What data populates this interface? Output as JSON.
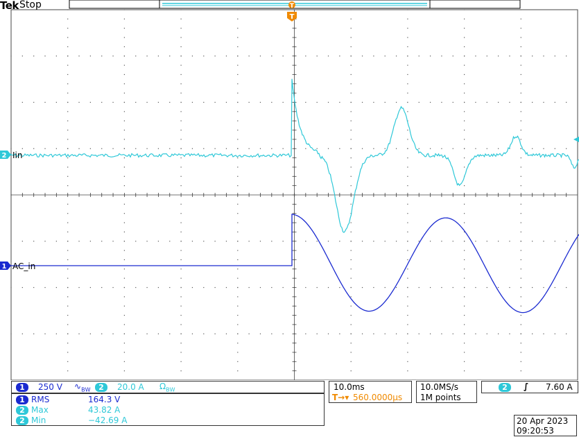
{
  "header": {
    "brand": "Tek",
    "status": "Stop"
  },
  "colors": {
    "ch1": "#1a2ad0",
    "ch2": "#2ec8d8",
    "trigger": "#f08a00",
    "grid": "#555555"
  },
  "trigger_marker": {
    "label": "T"
  },
  "channels": {
    "ch2": {
      "number": "2",
      "label": "Iin"
    },
    "ch1": {
      "number": "1",
      "label": "AC_in"
    }
  },
  "vertical_settings": {
    "ch1": {
      "number": "1",
      "scale": "250 V",
      "coupling_icon": "bandwidth-icon"
    },
    "ch2": {
      "number": "2",
      "scale": "20.0 A",
      "coupling_icon": "ohm-bandwidth-icon"
    }
  },
  "measurements": [
    {
      "channel": "1",
      "name": "RMS",
      "value": "164.3 V"
    },
    {
      "channel": "2",
      "name": "Max",
      "value": "43.82 A"
    },
    {
      "channel": "2",
      "name": "Min",
      "value": "−42.69 A"
    }
  ],
  "timebase": {
    "scale": "10.0ms",
    "delay": "560.0000µs",
    "delay_icon": "trigger-delay-icon"
  },
  "acquisition": {
    "sample_rate": "10.0MS/s",
    "record_length": "1M points"
  },
  "trigger": {
    "source": "2",
    "slope_icon": "rising-edge-icon",
    "level": "7.60 A"
  },
  "datetime": {
    "date": "20 Apr  2023",
    "time": "09:20:53"
  }
}
